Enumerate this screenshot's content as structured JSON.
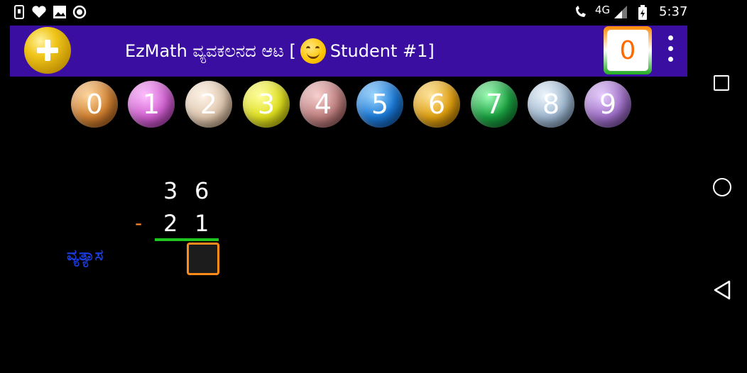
{
  "status_bar": {
    "network": "4G",
    "call_badge": "4G",
    "time": "5:37"
  },
  "app_bar": {
    "title_prefix": "EzMath ವ್ಯವಕಲನದ ಆಟ [",
    "title_suffix": "Student #1]",
    "score": "0"
  },
  "digit_buttons": [
    {
      "label": "0",
      "color": "#d08030"
    },
    {
      "label": "1",
      "color": "#d060d0"
    },
    {
      "label": "2",
      "color": "#e0c8b0"
    },
    {
      "label": "3",
      "color": "#e0e020"
    },
    {
      "label": "4",
      "color": "#c08080"
    },
    {
      "label": "5",
      "color": "#1a7ad8"
    },
    {
      "label": "6",
      "color": "#e0a010"
    },
    {
      "label": "7",
      "color": "#1aa040"
    },
    {
      "label": "8",
      "color": "#a0b8d0"
    },
    {
      "label": "9",
      "color": "#a070c8"
    }
  ],
  "problem": {
    "top_digits": [
      "3",
      "6"
    ],
    "operator": "-",
    "bottom_digits": [
      "2",
      "1"
    ],
    "answer_label": "ವ್ಯತ್ಯಾಸ"
  },
  "colors": {
    "app_bar": "#3a0ea0",
    "underline": "#1fc61f",
    "answer_border": "#ff8c1a",
    "answer_label": "#1a3bdc"
  }
}
